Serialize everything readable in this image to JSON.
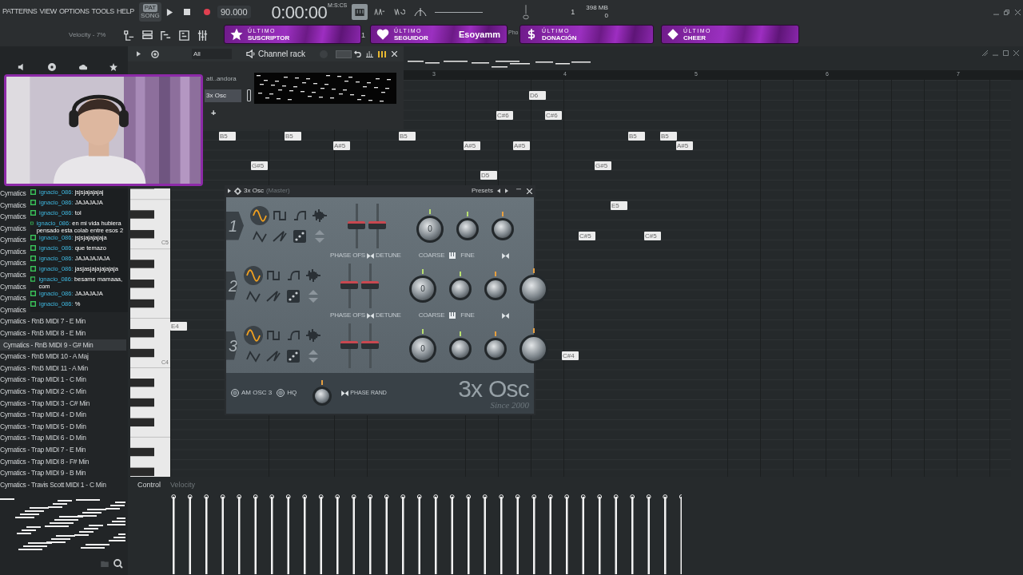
{
  "menu": [
    "PATTERNS",
    "VIEW",
    "OPTIONS",
    "TOOLS",
    "HELP"
  ],
  "transport": {
    "modes": [
      {
        "label": "PAT",
        "selected": true
      },
      {
        "label": "SONG",
        "selected": false
      }
    ],
    "tempo": "90.000",
    "time": "0:00:00",
    "time_unit": "M:S:CS",
    "cpu": "1",
    "memory": "398 MB",
    "polyphony": "0"
  },
  "hint": "Velocity - 7%",
  "toolbar_texts": [
    "1",
    "Pho"
  ],
  "alerts": [
    {
      "kind": "star",
      "title": "ÚLTIMO",
      "label": "SUSCRIPTOR"
    },
    {
      "kind": "heart",
      "title": "ÚLTIMO",
      "label": "SEGUIDOR",
      "value": "Esoyamm"
    },
    {
      "kind": "dollar",
      "title": "ÚLTIMO",
      "label": "DONACIÓN"
    },
    {
      "kind": "diamond",
      "title": "ÚLTIMO",
      "label": "CHEER"
    }
  ],
  "channel_rack": {
    "filter": "All",
    "title": "Channel rack",
    "channels": [
      {
        "name": "ati..andora",
        "selected": false
      },
      {
        "name": "3x Osc",
        "selected": true
      }
    ],
    "add": "+"
  },
  "piano_roll": {
    "ruler": [
      "3",
      "4",
      "5",
      "6",
      "7"
    ],
    "keys": [
      "C5",
      "C4"
    ],
    "notes": [
      "B5",
      "B5",
      "A#5",
      "B5",
      "G#5",
      "D6",
      "C#6",
      "C#6",
      "A#5",
      "A#5",
      "D5",
      "B5",
      "B5",
      "A#5",
      "G#5",
      "E5",
      "C#5",
      "C#5",
      "E4",
      "C#4"
    ],
    "control": {
      "label": "Control",
      "target": "Velocity"
    }
  },
  "browser": {
    "items": [
      {
        "name": "Cymatics",
        "selected": false
      },
      {
        "name": "Cymatics",
        "selected": false
      },
      {
        "name": "Cymatics",
        "selected": false
      },
      {
        "name": "Cymatics",
        "selected": false
      },
      {
        "name": "Cymatics",
        "selected": false
      },
      {
        "name": "Cymatics",
        "selected": false
      },
      {
        "name": "Cymatics",
        "selected": false
      },
      {
        "name": "Cymatics",
        "selected": false
      },
      {
        "name": "Cymatics",
        "selected": false
      },
      {
        "name": "Cymatics",
        "selected": false
      },
      {
        "name": "Cymatics",
        "selected": false
      },
      {
        "name": "Cymatics - RnB MIDI 7 - E Min",
        "selected": false
      },
      {
        "name": "Cymatics - RnB MIDI 8 - E Min",
        "selected": false
      },
      {
        "name": "Cymatics - RnB MIDI 9 - G# Min",
        "selected": true
      },
      {
        "name": "Cymatics - RnB MIDI 10 - A Maj",
        "selected": false
      },
      {
        "name": "Cymatics - RnB MIDI 11 - A Min",
        "selected": false
      },
      {
        "name": "Cymatics - Trap MIDI 1 - C Min",
        "selected": false
      },
      {
        "name": "Cymatics - Trap MIDI 2 - C Min",
        "selected": false
      },
      {
        "name": "Cymatics - Trap MIDI 3 - C# Min",
        "selected": false
      },
      {
        "name": "Cymatics - Trap MIDI 4 - D Min",
        "selected": false
      },
      {
        "name": "Cymatics - Trap MIDI 5 - D Min",
        "selected": false
      },
      {
        "name": "Cymatics - Trap MIDI 6 - D Min",
        "selected": false
      },
      {
        "name": "Cymatics - Trap MIDI 7 - E Min",
        "selected": false
      },
      {
        "name": "Cymatics - Trap MIDI 8 - F# Min",
        "selected": false
      },
      {
        "name": "Cymatics - Trap MIDI 9 - B Min",
        "selected": false
      },
      {
        "name": "Cymatics - Travis Scott MIDI 1 - C Min",
        "selected": false
      }
    ]
  },
  "chat": [
    {
      "user": "ignacio_086:",
      "text": "jsjsjajajajaj"
    },
    {
      "user": "ignacio_086:",
      "text": "JAJAJAJA"
    },
    {
      "user": "ignacio_086:",
      "text": "tol"
    },
    {
      "user": "ignacio_086:",
      "text": "en mi vida hubiera pensado esta colab entre esos 2"
    },
    {
      "user": "ignacio_086:",
      "text": "jsjsjajajajaja"
    },
    {
      "user": "ignacio_086:",
      "text": "que temazo"
    },
    {
      "user": "ignacio_086:",
      "text": "JAJAJAJAJA"
    },
    {
      "user": "ignacio_086:",
      "text": "jasjasjajajajajaja"
    },
    {
      "user": "ignacio_086:",
      "text": "besame mamaaa, com"
    },
    {
      "user": "ignacio_086:",
      "text": "JAJAJAJA"
    },
    {
      "user": "ignacio_086:",
      "text": "%"
    }
  ],
  "plugin": {
    "title": "3x Osc",
    "subtitle": "(Master)",
    "presets": "Presets",
    "oscillators": [
      {
        "label": "1",
        "coarse": "0",
        "has_volume": false,
        "captions": [
          "PHASE OFS",
          "DETUNE",
          "COARSE",
          "FINE"
        ],
        "waves": [
          {
            "kind": "sine",
            "selected": true
          },
          {
            "kind": "square",
            "selected": false
          },
          {
            "kind": "pulse",
            "selected": false
          },
          {
            "kind": "noise",
            "selected": false
          },
          {
            "kind": "triangle",
            "selected": false
          },
          {
            "kind": "saw",
            "selected": false
          },
          {
            "kind": "random",
            "selected": false
          },
          {
            "kind": "custom",
            "selected": false
          }
        ]
      },
      {
        "label": "2",
        "coarse": "0",
        "has_volume": true,
        "captions": [
          "PHASE OFS",
          "DETUNE",
          "COARSE",
          "FINE"
        ],
        "waves": [
          {
            "kind": "sine",
            "selected": true
          },
          {
            "kind": "square",
            "selected": false
          },
          {
            "kind": "pulse",
            "selected": false
          },
          {
            "kind": "noise",
            "selected": false
          },
          {
            "kind": "triangle",
            "selected": false
          },
          {
            "kind": "saw",
            "selected": false
          },
          {
            "kind": "random",
            "selected": false
          },
          {
            "kind": "custom",
            "selected": false
          }
        ]
      },
      {
        "label": "3",
        "coarse": "0",
        "has_volume": true,
        "waves": [
          {
            "kind": "sine",
            "selected": true
          },
          {
            "kind": "square",
            "selected": false
          },
          {
            "kind": "pulse",
            "selected": false
          },
          {
            "kind": "noise",
            "selected": false
          },
          {
            "kind": "triangle",
            "selected": false
          },
          {
            "kind": "saw",
            "selected": false
          },
          {
            "kind": "random",
            "selected": false
          },
          {
            "kind": "custom",
            "selected": false
          }
        ]
      }
    ],
    "options": [
      {
        "label": "AM OSC 3",
        "checked": false
      },
      {
        "label": "HQ",
        "checked": false
      }
    ],
    "phase_rand": "PHASE RAND",
    "logo": "3x Osc",
    "since": "Since 2000"
  }
}
